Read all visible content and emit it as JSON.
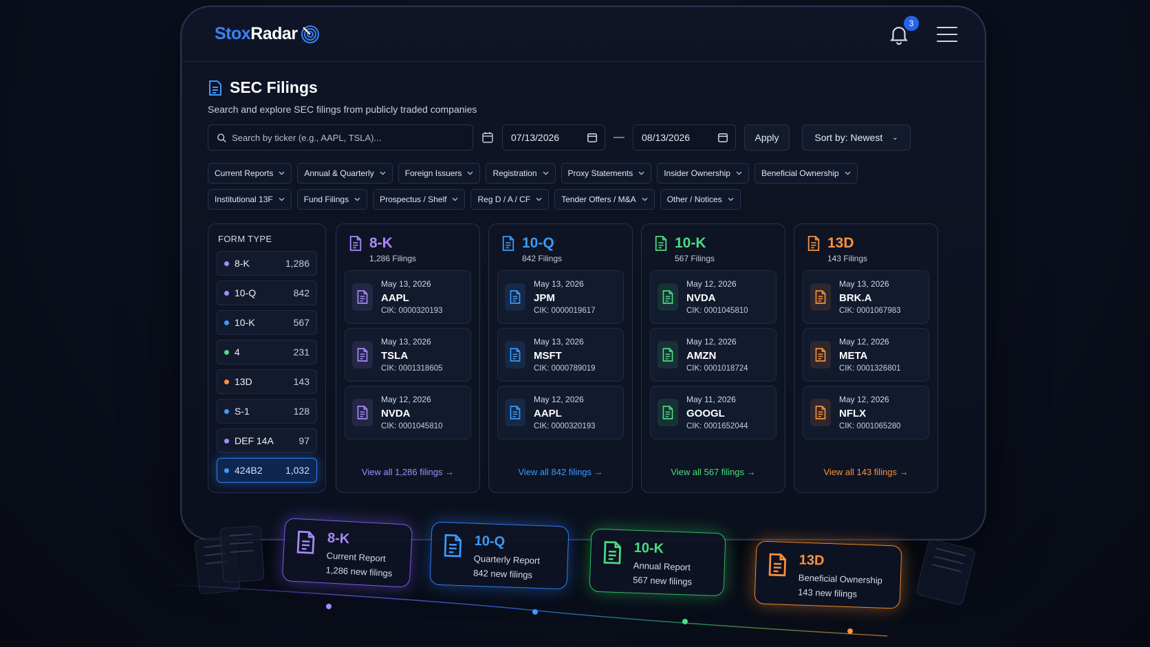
{
  "app": {
    "logo_part1": "Stox",
    "logo_part2": "Radar",
    "notification_count": "3"
  },
  "page": {
    "title": "SEC Filings",
    "subtitle": "Search and explore SEC filings from publicly traded companies"
  },
  "search": {
    "placeholder": "Search by ticker (e.g., AAPL, TSLA)...",
    "date_from": "07/13/2026",
    "date_to": "08/13/2026",
    "apply_label": "Apply",
    "sort_label": "Sort by: Newest"
  },
  "filters": [
    "Current Reports",
    "Annual & Quarterly",
    "Foreign Issuers",
    "Registration",
    "Proxy Statements",
    "Insider Ownership",
    "Beneficial Ownership",
    "Institutional 13F",
    "Fund Filings",
    "Prospectus / Shelf",
    "Reg D / A / CF",
    "Tender Offers / M&A",
    "Other / Notices"
  ],
  "form_type": {
    "header": "FORM TYPE",
    "items": [
      {
        "label": "8-K",
        "count": "1,286",
        "color": "#a78bfa"
      },
      {
        "label": "10-Q",
        "count": "842",
        "color": "#a78bfa"
      },
      {
        "label": "10-K",
        "count": "567",
        "color": "#3b9bff"
      },
      {
        "label": "4",
        "count": "231",
        "color": "#4ade80"
      },
      {
        "label": "13D",
        "count": "143",
        "color": "#fb923c"
      },
      {
        "label": "S-1",
        "count": "128",
        "color": "#3b9bff"
      },
      {
        "label": "DEF 14A",
        "count": "97",
        "color": "#a78bfa"
      },
      {
        "label": "424B2",
        "count": "1,032",
        "color": "#3b9bff"
      }
    ]
  },
  "columns": [
    {
      "form": "8-K",
      "count_label": "1,286 Filings",
      "color": "#a78bfa",
      "filings": [
        {
          "date": "May 13, 2026",
          "ticker": "AAPL",
          "cik": "CIK: 0000320193"
        },
        {
          "date": "May 13, 2026",
          "ticker": "TSLA",
          "cik": "CIK: 0001318605"
        },
        {
          "date": "May 12, 2026",
          "ticker": "NVDA",
          "cik": "CIK: 0001045810"
        }
      ],
      "view_all": "View all 1,286 filings"
    },
    {
      "form": "10-Q",
      "count_label": "842 Filings",
      "color": "#3b9bff",
      "filings": [
        {
          "date": "May 13, 2026",
          "ticker": "JPM",
          "cik": "CIK: 0000019617"
        },
        {
          "date": "May 13, 2026",
          "ticker": "MSFT",
          "cik": "CIK: 0000789019"
        },
        {
          "date": "May 12, 2026",
          "ticker": "AAPL",
          "cik": "CIK: 0000320193"
        }
      ],
      "view_all": "View all 842 filings"
    },
    {
      "form": "10-K",
      "count_label": "567 Filings",
      "color": "#4ade80",
      "filings": [
        {
          "date": "May 12, 2026",
          "ticker": "NVDA",
          "cik": "CIK: 0001045810"
        },
        {
          "date": "May 12, 2026",
          "ticker": "AMZN",
          "cik": "CIK: 0001018724"
        },
        {
          "date": "May 11, 2026",
          "ticker": "GOOGL",
          "cik": "CIK: 0001652044"
        }
      ],
      "view_all": "View all 567 filings"
    },
    {
      "form": "13D",
      "count_label": "143 Filings",
      "color": "#fb923c",
      "filings": [
        {
          "date": "May 13, 2026",
          "ticker": "BRK.A",
          "cik": "CIK: 0001067983"
        },
        {
          "date": "May 12, 2026",
          "ticker": "META",
          "cik": "CIK: 0001326801"
        },
        {
          "date": "May 12, 2026",
          "ticker": "NFLX",
          "cik": "CIK: 0001065280"
        }
      ],
      "view_all": "View all 143 filings"
    }
  ],
  "summary_cards": [
    {
      "form": "8-K",
      "type": "Current Report",
      "new": "1,286 new filings",
      "color": "#a78bfa"
    },
    {
      "form": "10-Q",
      "type": "Quarterly Report",
      "new": "842 new filings",
      "color": "#3b9bff"
    },
    {
      "form": "10-K",
      "type": "Annual Report",
      "new": "567 new filings",
      "color": "#4ade80"
    },
    {
      "form": "13D",
      "type": "Beneficial Ownership",
      "new": "143 new filings",
      "color": "#fb923c"
    }
  ]
}
